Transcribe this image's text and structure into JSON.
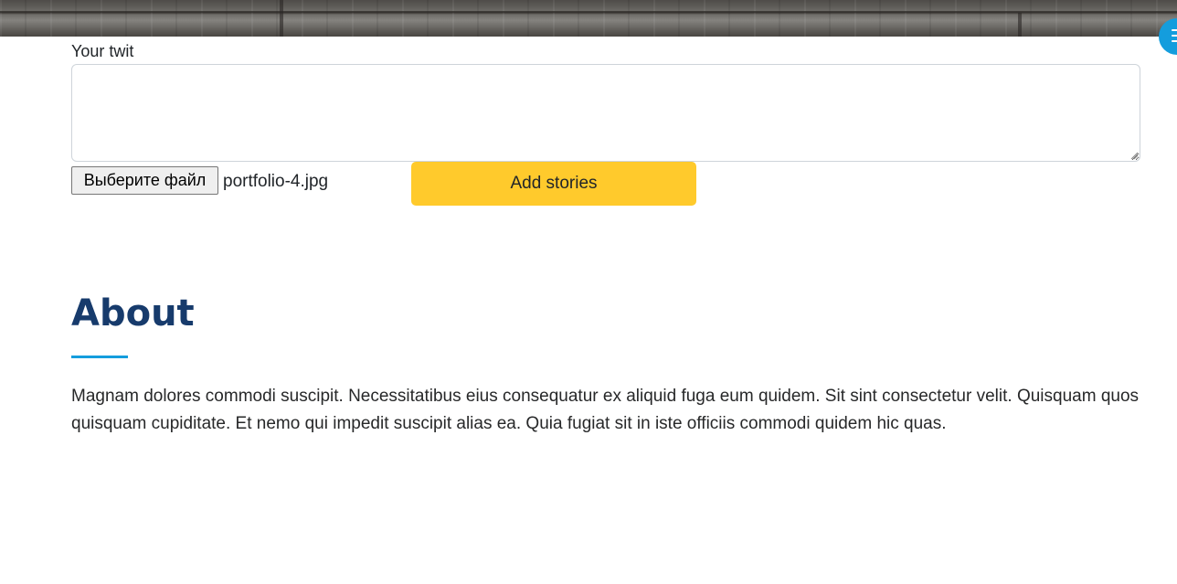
{
  "form": {
    "label": "Your twit",
    "textarea_value": "",
    "file_button_label": "Выберите файл",
    "file_name": "portfolio-4.jpg",
    "submit_label": "Add stories"
  },
  "about": {
    "title": "About",
    "paragraph": "Magnam dolores commodi suscipit. Necessitatibus eius consequatur ex aliquid fuga eum quidem. Sit sint consectetur velit. Quisquam quos quisquam cupiditate. Et nemo qui impedit suscipit alias ea. Quia fugiat sit in iste officiis commodi quidem hic quas."
  },
  "icons": {
    "menu_toggle": "hamburger-menu-icon",
    "textarea_grip": "resize-grip-icon"
  },
  "colors": {
    "accent": "#149ddd",
    "heading": "#173b6c",
    "submit_button": "#ffca2c"
  }
}
